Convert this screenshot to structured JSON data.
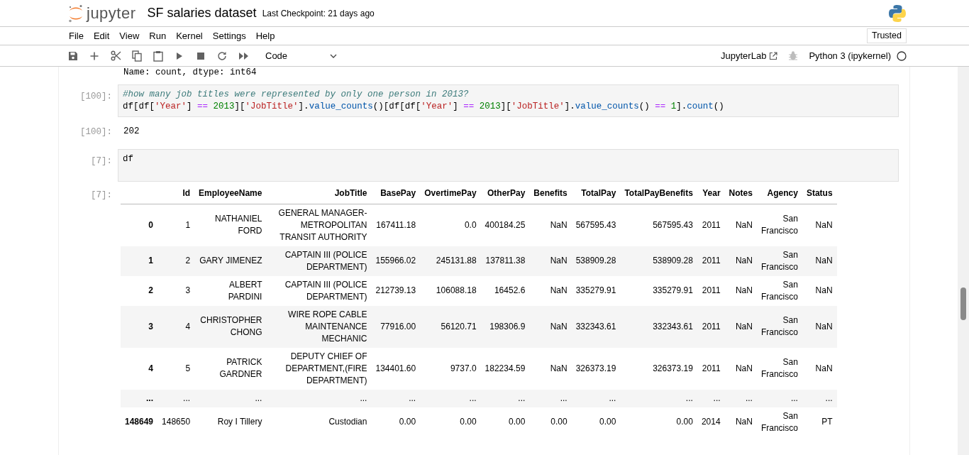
{
  "header": {
    "logo_text": "jupyter",
    "title": "SF salaries dataset",
    "checkpoint": "Last Checkpoint: 21 days ago"
  },
  "menu": [
    "File",
    "Edit",
    "View",
    "Run",
    "Kernel",
    "Settings",
    "Help"
  ],
  "trusted": "Trusted",
  "toolbar": {
    "tools": [
      {
        "kind": "save"
      },
      {
        "kind": "add"
      },
      {
        "kind": "cut"
      },
      {
        "kind": "copy"
      },
      {
        "kind": "paste"
      },
      {
        "kind": "run"
      },
      {
        "kind": "stop"
      },
      {
        "kind": "restart"
      },
      {
        "kind": "run-all"
      }
    ],
    "cell_type": "Code",
    "open_in": "JupyterLab",
    "kernel": "Python 3 (ipykernel)"
  },
  "cells": [
    {
      "kind": "stream",
      "text": "Name: count, dtype: int64"
    },
    {
      "kind": "code",
      "prompt": "[100]:",
      "lines": [
        [
          {
            "kind": "comment",
            "text": "#how many job titles were represented by only one person in 2013?"
          }
        ],
        [
          {
            "kind": "plain",
            "text": "df[df["
          },
          {
            "kind": "string",
            "text": "'Year'"
          },
          {
            "kind": "plain",
            "text": "] "
          },
          {
            "kind": "operator",
            "text": "=="
          },
          {
            "kind": "number",
            "text": " 2013"
          },
          {
            "kind": "plain",
            "text": "]["
          },
          {
            "kind": "string",
            "text": "'JobTitle'"
          },
          {
            "kind": "plain",
            "text": "]."
          },
          {
            "kind": "property",
            "text": "value_counts"
          },
          {
            "kind": "plain",
            "text": "()[df[df["
          },
          {
            "kind": "string",
            "text": "'Year'"
          },
          {
            "kind": "plain",
            "text": "] "
          },
          {
            "kind": "operator",
            "text": "=="
          },
          {
            "kind": "number",
            "text": " 2013"
          },
          {
            "kind": "plain",
            "text": "]["
          },
          {
            "kind": "string",
            "text": "'JobTitle'"
          },
          {
            "kind": "plain",
            "text": "]."
          },
          {
            "kind": "property",
            "text": "value_counts"
          },
          {
            "kind": "plain",
            "text": "() "
          },
          {
            "kind": "operator",
            "text": "=="
          },
          {
            "kind": "number",
            "text": " 1"
          },
          {
            "kind": "plain",
            "text": "]."
          },
          {
            "kind": "property",
            "text": "count"
          },
          {
            "kind": "plain",
            "text": "()"
          }
        ]
      ]
    },
    {
      "kind": "result",
      "prompt": "[100]:",
      "text": "202"
    },
    {
      "kind": "code",
      "prompt": "[7]:",
      "lines": [
        [
          {
            "kind": "plain",
            "text": "df"
          }
        ]
      ]
    },
    {
      "kind": "table",
      "prompt": "[7]:",
      "columns": [
        "Id",
        "EmployeeName",
        "JobTitle",
        "BasePay",
        "OvertimePay",
        "OtherPay",
        "Benefits",
        "TotalPay",
        "TotalPayBenefits",
        "Year",
        "Notes",
        "Agency",
        "Status"
      ],
      "rows": [
        {
          "index": "0",
          "cells": [
            "1",
            "NATHANIEL FORD",
            "GENERAL MANAGER-METROPOLITAN TRANSIT AUTHORITY",
            "167411.18",
            "0.0",
            "400184.25",
            "NaN",
            "567595.43",
            "567595.43",
            "2011",
            "NaN",
            "San Francisco",
            "NaN"
          ]
        },
        {
          "index": "1",
          "cells": [
            "2",
            "GARY JIMENEZ",
            "CAPTAIN III (POLICE DEPARTMENT)",
            "155966.02",
            "245131.88",
            "137811.38",
            "NaN",
            "538909.28",
            "538909.28",
            "2011",
            "NaN",
            "San Francisco",
            "NaN"
          ]
        },
        {
          "index": "2",
          "cells": [
            "3",
            "ALBERT PARDINI",
            "CAPTAIN III (POLICE DEPARTMENT)",
            "212739.13",
            "106088.18",
            "16452.6",
            "NaN",
            "335279.91",
            "335279.91",
            "2011",
            "NaN",
            "San Francisco",
            "NaN"
          ]
        },
        {
          "index": "3",
          "cells": [
            "4",
            "CHRISTOPHER CHONG",
            "WIRE ROPE CABLE MAINTENANCE MECHANIC",
            "77916.00",
            "56120.71",
            "198306.9",
            "NaN",
            "332343.61",
            "332343.61",
            "2011",
            "NaN",
            "San Francisco",
            "NaN"
          ]
        },
        {
          "index": "4",
          "cells": [
            "5",
            "PATRICK GARDNER",
            "DEPUTY CHIEF OF DEPARTMENT,(FIRE DEPARTMENT)",
            "134401.60",
            "9737.0",
            "182234.59",
            "NaN",
            "326373.19",
            "326373.19",
            "2011",
            "NaN",
            "San Francisco",
            "NaN"
          ]
        },
        {
          "index": "...",
          "cells": [
            "...",
            "...",
            "...",
            "...",
            "...",
            "...",
            "...",
            "...",
            "...",
            "...",
            "...",
            "...",
            "..."
          ]
        },
        {
          "index": "148649",
          "cells": [
            "148650",
            "Roy I Tillery",
            "Custodian",
            "0.00",
            "0.00",
            "0.00",
            "0.00",
            "0.00",
            "0.00",
            "2014",
            "NaN",
            "San Francisco",
            "PT"
          ]
        }
      ]
    }
  ]
}
